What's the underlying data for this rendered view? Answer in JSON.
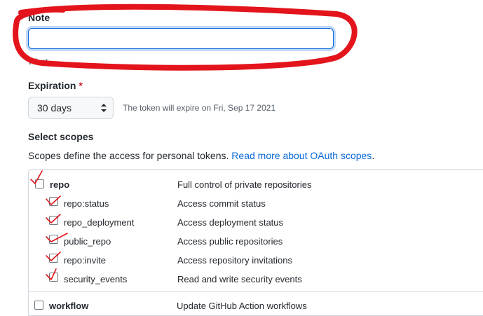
{
  "note": {
    "label": "Note",
    "value": "",
    "hint": "What"
  },
  "expiration": {
    "label": "Expiration",
    "required_mark": "*",
    "selected": "30 days",
    "expires_text": "The token will expire on Fri, Sep 17 2021"
  },
  "scopes": {
    "heading": "Select scopes",
    "description": "Scopes define the access for personal tokens.",
    "link_text": "Read more about OAuth scopes",
    "link_suffix": ".",
    "items": [
      {
        "name": "repo",
        "desc": "Full control of private repositories",
        "checked": false
      },
      {
        "name": "repo:status",
        "desc": "Access commit status",
        "checked": false
      },
      {
        "name": "repo_deployment",
        "desc": "Access deployment status",
        "checked": false
      },
      {
        "name": "public_repo",
        "desc": "Access public repositories",
        "checked": false
      },
      {
        "name": "repo:invite",
        "desc": "Access repository invitations",
        "checked": false
      },
      {
        "name": "security_events",
        "desc": "Read and write security events",
        "checked": false
      },
      {
        "name": "workflow",
        "desc": "Update GitHub Action workflows",
        "checked": false
      }
    ]
  },
  "annotation": {
    "color": "#e3141b"
  }
}
